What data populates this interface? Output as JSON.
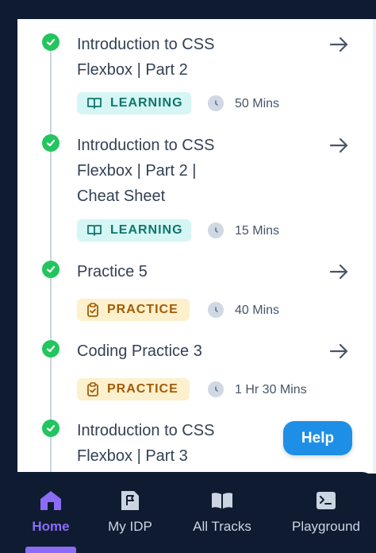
{
  "items": [
    {
      "title_lines": [
        "Introduction to CSS",
        "Flexbox | Part 2"
      ],
      "tag": "LEARNING",
      "duration": "50 Mins"
    },
    {
      "title_lines": [
        "Introduction to CSS",
        "Flexbox | Part 2 |",
        "Cheat Sheet"
      ],
      "tag": "LEARNING",
      "duration": "15 Mins"
    },
    {
      "title_lines": [
        "Practice 5"
      ],
      "tag": "PRACTICE",
      "duration": "40 Mins"
    },
    {
      "title_lines": [
        "Coding Practice 3"
      ],
      "tag": "PRACTICE",
      "duration": "1 Hr 30 Mins"
    },
    {
      "title_lines": [
        "Introduction to CSS",
        "Flexbox | Part 3"
      ]
    }
  ],
  "help_button": "Help",
  "nav": {
    "home": "Home",
    "my_idp": "My IDP",
    "all_tracks": "All Tracks",
    "playground": "Playground"
  },
  "colors": {
    "background_dark": "#0f1b31",
    "check_green": "#22c55e",
    "learning_tag_bg": "#d5f6f4",
    "practice_tag_bg": "#fdf0cc",
    "help_blue": "#1d8fe6",
    "active_purple": "#8b6cf6"
  }
}
